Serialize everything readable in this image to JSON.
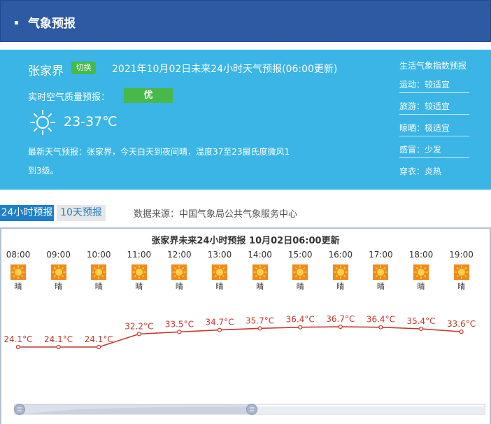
{
  "header": {
    "title": "气象预报"
  },
  "current": {
    "city": "张家界",
    "switch_label": "切换",
    "forecast_title": "2021年10月02日未来24小时天气预报(06:00更新)",
    "air_quality_label": "实时空气质量预报：",
    "air_quality_value": "优",
    "weather_icon": "sun-icon",
    "temp_range": "23-37℃",
    "latest_forecast": "最新天气预报：张家界，今天白天到夜间晴，温度37至23摄氏度微风1到3级。"
  },
  "life_index": {
    "title": "生活气象指数预报",
    "items": [
      {
        "label": "运动：较适宜"
      },
      {
        "label": "旅游：较适宜"
      },
      {
        "label": "晾晒：极适宜"
      },
      {
        "label": "感冒：少发"
      },
      {
        "label": "穿衣：炎热"
      }
    ]
  },
  "tabs": [
    {
      "label": "24小时预报",
      "active": true
    },
    {
      "label": "10天预报",
      "active": false
    }
  ],
  "source": "数据来源：中国气象局公共气象服务中心",
  "colors": {
    "header_bg": "#2d5aa2",
    "panel_bg": "#3ab5e6",
    "badge_green": "#47b94a",
    "tab_active": "#1e7fc8",
    "line_red": "#c0392b"
  },
  "chart_data": {
    "type": "line",
    "title": "张家界未来24小时预报    10月02日06:00更新",
    "categories": [
      "08:00",
      "09:00",
      "10:00",
      "11:00",
      "12:00",
      "13:00",
      "14:00",
      "15:00",
      "16:00",
      "17:00",
      "18:00",
      "19:00"
    ],
    "weather": [
      "晴",
      "晴",
      "晴",
      "晴",
      "晴",
      "晴",
      "晴",
      "晴",
      "晴",
      "晴",
      "晴",
      "晴"
    ],
    "values": [
      24.1,
      24.1,
      24.1,
      32.2,
      33.5,
      34.7,
      35.7,
      36.4,
      36.7,
      36.4,
      35.4,
      33.6
    ],
    "labels": [
      "24.1°C",
      "24.1°C",
      "24.1°C",
      "32.2°C",
      "33.5°C",
      "34.7°C",
      "35.7°C",
      "36.4°C",
      "36.7°C",
      "36.4°C",
      "35.4°C",
      "33.6°C"
    ],
    "grid": false
  }
}
